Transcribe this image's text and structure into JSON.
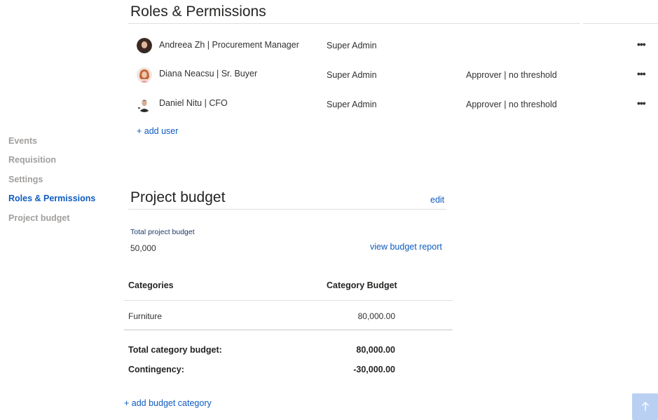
{
  "nav": {
    "items": [
      {
        "label": "Events",
        "active": false
      },
      {
        "label": "Requisition",
        "active": false
      },
      {
        "label": "Settings",
        "active": false
      },
      {
        "label": "Roles & Permissions",
        "active": true
      },
      {
        "label": "Project budget",
        "active": false
      }
    ]
  },
  "roles": {
    "title": "Roles & Permissions",
    "users": [
      {
        "name": "Andreea Zh | Procurement Manager",
        "role": "Super Admin",
        "approval": "",
        "avatar": "avatar-dark-hair"
      },
      {
        "name": "Diana Neacsu | Sr. Buyer",
        "role": "Super Admin",
        "approval": "Approver | no threshold",
        "avatar": "avatar-red-hair"
      },
      {
        "name": "Daniel Nitu | CFO",
        "role": "Super Admin",
        "approval": "Approver | no threshold",
        "avatar": "avatar-man"
      }
    ],
    "more_label": "•••",
    "add_user": "+ add user"
  },
  "budget": {
    "title": "Project budget",
    "edit": "edit",
    "total_label": "Total project budget",
    "total_value": "50,000",
    "view_report": "view budget report",
    "table": {
      "headers": [
        "Categories",
        "Category Budget"
      ],
      "rows": [
        [
          "Furniture",
          "80,000.00"
        ]
      ]
    },
    "totals": [
      {
        "label": "Total category budget:",
        "value": "80,000.00"
      },
      {
        "label": "Contingency:",
        "value": "-30,000.00"
      }
    ],
    "add_category": "+ add budget category"
  },
  "scroll_top_icon": "arrow-up-icon",
  "colors": {
    "accent": "#0f5cc0",
    "nav_inactive": "#a19f9d",
    "scroll_button": "#b9d0f3"
  }
}
